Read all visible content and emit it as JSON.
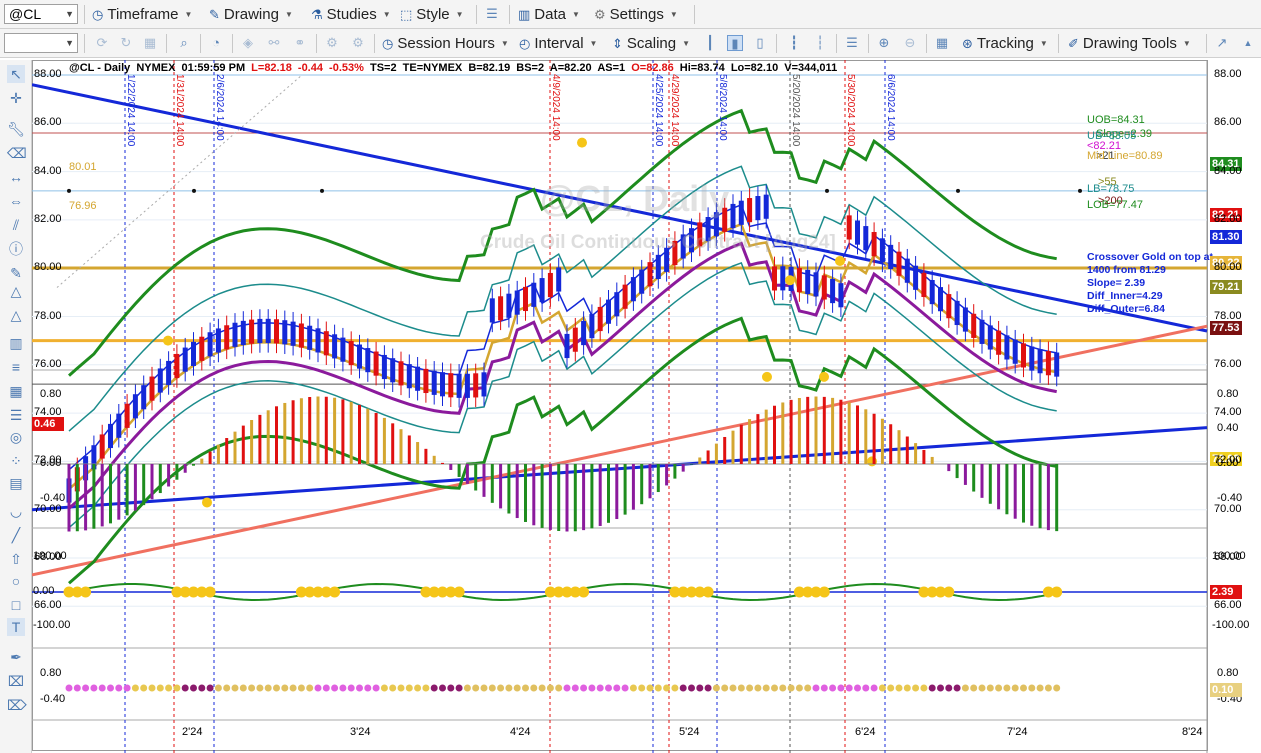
{
  "toolbar1": {
    "symbol": "@CL",
    "timeframe": "Timeframe",
    "drawing": "Drawing",
    "studies": "Studies",
    "style": "Style",
    "data": "Data",
    "settings": "Settings"
  },
  "toolbar2": {
    "session_hours": "Session Hours",
    "interval": "Interval",
    "scaling": "Scaling",
    "tracking": "Tracking",
    "drawing_tools": "Drawing Tools"
  },
  "header": {
    "symbol": "@CL - Daily",
    "exchange": "NYMEX",
    "time": "01:59:59 PM",
    "last": "L=82.18",
    "change": "-0.44",
    "pct": "-0.53%",
    "ts": "TS=2",
    "te": "TE=NYMEX",
    "bid": "B=82.19",
    "bs": "BS=2",
    "ask": "A=82.20",
    "as": "AS=1",
    "open": "O=82.86",
    "hi": "Hi=83.74",
    "lo": "Lo=82.10",
    "vol": "V=344,011"
  },
  "watermark": {
    "symbol": "@CL, Daily",
    "name": "Crude Oil Continuous Contract [Aug24]"
  },
  "price_axis": [
    "88.00",
    "86.00",
    "84.00",
    "82.00",
    "80.00",
    "78.00",
    "76.00",
    "74.00",
    "72.00",
    "70.00",
    "68.00",
    "66.00"
  ],
  "osc_axis": [
    "0.80",
    "0.40",
    "0.00",
    "-0.40"
  ],
  "osc2_axis": [
    "100.00",
    "0.00",
    "-100.00"
  ],
  "osc3_axis": [
    "0.80",
    "-0.40"
  ],
  "date_axis": [
    "2'24",
    "3'24",
    "4'24",
    "5'24",
    "6'24",
    "7'24",
    "8'24"
  ],
  "vertical_dates": [
    {
      "text": "1/22/2024 14:00",
      "color": "#1428d8"
    },
    {
      "text": "1/31/2024 14:00",
      "color": "#e01010"
    },
    {
      "text": "2/6/2024 14:00",
      "color": "#1428d8"
    },
    {
      "text": "4/9/2024 14:00",
      "color": "#e01010"
    },
    {
      "text": "4/25/2024 14:00",
      "color": "#1428d8"
    },
    {
      "text": "4/29/2024 14:00",
      "color": "#e01010"
    },
    {
      "text": "5/8/2024 14:00",
      "color": "#1428d8"
    },
    {
      "text": "5/20/2024 14:00",
      "color": "#555555"
    },
    {
      "text": "5/30/2024 14:00",
      "color": "#e01010"
    },
    {
      "text": "6/6/2024 14:00",
      "color": "#1428d8"
    }
  ],
  "level_labels": {
    "level1": "80.01",
    "level2": "76.96"
  },
  "legend": {
    "uob": "UOB=84.31",
    "slope": "Slope=2.39",
    "ub": "UB=83.05",
    "price": "<82.21",
    "c21": ">21",
    "mid": "Mid Line=80.89",
    "c55": ">55",
    "lb": "LB=78.75",
    "c200": ">200",
    "lob": "LOB=77.47"
  },
  "price_tags": [
    {
      "text": "84.31",
      "color": "#1e8c1e"
    },
    {
      "text": "82.21",
      "color": "#e01010"
    },
    {
      "text": "81.30",
      "color": "#1428d8"
    },
    {
      "text": "80.22",
      "color": "#e6b53a"
    },
    {
      "text": "79.21",
      "color": "#8a8a20"
    },
    {
      "text": "77.53",
      "color": "#7a1010"
    },
    {
      "text": "72.08",
      "color": "#f0d020"
    }
  ],
  "osc_tag": "0.46",
  "osc2_tag": "2.39",
  "osc3_tag": "0.10",
  "annotation": [
    "Crossover Gold on top at",
    "1400 from 81.29",
    "Slope= 2.39",
    "Diff_Inner=4.29",
    "Diff_Outer=6.84"
  ],
  "colors": {
    "up": "#1428d8",
    "down": "#e01010",
    "uob": "#1e8c1e",
    "mid": "#d4a630",
    "trend": "#1428d8",
    "trend_rising": "#f07060",
    "hist_red": "#e01010",
    "hist_gold": "#d4a630",
    "hist_green": "#1e8c1e",
    "hist_purple": "#8b1a9c"
  }
}
